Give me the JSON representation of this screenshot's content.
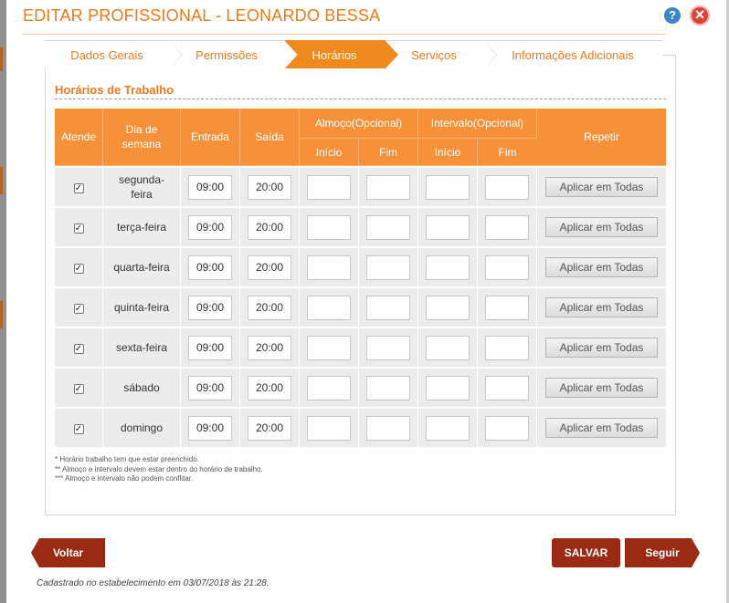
{
  "dialog": {
    "title": "EDITAR PROFISSIONAL - LEONARDO BESSA",
    "help_glyph": "?",
    "close_glyph": "×",
    "icons": {
      "help": "help-icon",
      "close": "close-icon"
    }
  },
  "colors": {
    "accent": "#f18a1e",
    "title": "#ee7a1b",
    "primary_button": "#9a2a14",
    "help": "#3a86c8",
    "close": "#d8443a"
  },
  "tabs": [
    {
      "label": "Dados Gerais",
      "active": false
    },
    {
      "label": "Permissões",
      "active": false
    },
    {
      "label": "Horários",
      "active": true
    },
    {
      "label": "Serviços",
      "active": false
    },
    {
      "label": "Informações Adicionais",
      "active": false
    }
  ],
  "section": {
    "title": "Horários de Trabalho"
  },
  "table": {
    "headers": {
      "atende": "Atende",
      "dia": "Dia de semana",
      "entrada": "Entrada",
      "saida": "Saída",
      "almoco": "Almoço(Opcional)",
      "intervalo": "Intervalo(Opcional)",
      "inicio": "Início",
      "fim": "Fim",
      "repetir": "Repetir"
    },
    "apply_label": "Aplicar em Todas",
    "rows": [
      {
        "checked": true,
        "day": "segunda-feira",
        "entrada": "09:00",
        "saida": "20:00",
        "almoco_inicio": "",
        "almoco_fim": "",
        "intervalo_inicio": "",
        "intervalo_fim": ""
      },
      {
        "checked": true,
        "day": "terça-feira",
        "entrada": "09:00",
        "saida": "20:00",
        "almoco_inicio": "",
        "almoco_fim": "",
        "intervalo_inicio": "",
        "intervalo_fim": ""
      },
      {
        "checked": true,
        "day": "quarta-feira",
        "entrada": "09:00",
        "saida": "20:00",
        "almoco_inicio": "",
        "almoco_fim": "",
        "intervalo_inicio": "",
        "intervalo_fim": ""
      },
      {
        "checked": true,
        "day": "quinta-feira",
        "entrada": "09:00",
        "saida": "20:00",
        "almoco_inicio": "",
        "almoco_fim": "",
        "intervalo_inicio": "",
        "intervalo_fim": ""
      },
      {
        "checked": true,
        "day": "sexta-feira",
        "entrada": "09:00",
        "saida": "20:00",
        "almoco_inicio": "",
        "almoco_fim": "",
        "intervalo_inicio": "",
        "intervalo_fim": ""
      },
      {
        "checked": true,
        "day": "sábado",
        "entrada": "09:00",
        "saida": "20:00",
        "almoco_inicio": "",
        "almoco_fim": "",
        "intervalo_inicio": "",
        "intervalo_fim": ""
      },
      {
        "checked": true,
        "day": "domingo",
        "entrada": "09:00",
        "saida": "20:00",
        "almoco_inicio": "",
        "almoco_fim": "",
        "intervalo_inicio": "",
        "intervalo_fim": ""
      }
    ]
  },
  "notes": [
    "* Horário trabalho tem que estar preenchido.",
    "** Almoço e intervalo devem estar dentro do horário de trabalho.",
    "*** Almoço e intervalo não podem conflitar."
  ],
  "buttons": {
    "voltar": "Voltar",
    "salvar": "SALVAR",
    "seguir": "Seguir"
  },
  "footer": {
    "text": "Cadastrado no estabelecimento em 03/07/2018 às 21:28."
  }
}
